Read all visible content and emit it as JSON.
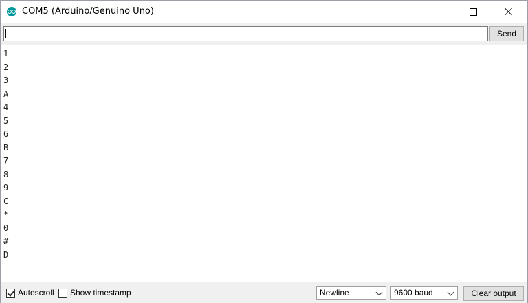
{
  "window": {
    "title": "COM5 (Arduino/Genuino Uno)"
  },
  "input": {
    "value": "",
    "send_label": "Send"
  },
  "output": {
    "lines": [
      "1",
      "2",
      "3",
      "A",
      "4",
      "5",
      "6",
      "B",
      "7",
      "8",
      "9",
      "C",
      "*",
      "0",
      "#",
      "D"
    ]
  },
  "footer": {
    "autoscroll_label": "Autoscroll",
    "autoscroll_checked": true,
    "timestamp_label": "Show timestamp",
    "timestamp_checked": false,
    "line_ending": "Newline",
    "baud_rate": "9600 baud",
    "clear_label": "Clear output"
  },
  "colors": {
    "app_icon": "#00979c",
    "bar_bg": "#f0f0f0"
  }
}
